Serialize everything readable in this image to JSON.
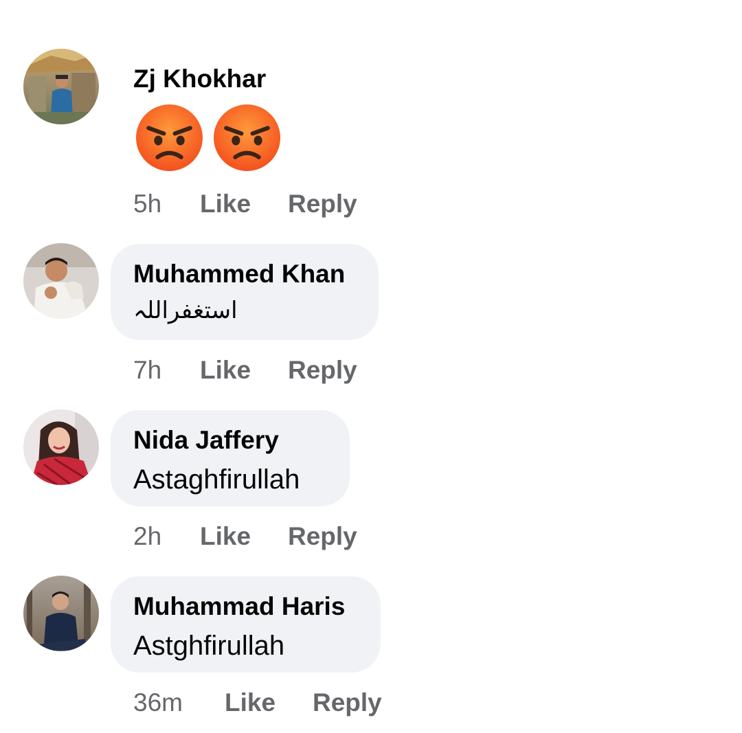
{
  "comments": [
    {
      "author": "Zj Khokhar",
      "reaction_icons": [
        "angry-face-emoji",
        "angry-face-emoji"
      ],
      "time": "5h",
      "like_label": "Like",
      "reply_label": "Reply"
    },
    {
      "author": "Muhammed Khan",
      "text": "استغفراللہ",
      "time": "7h",
      "like_label": "Like",
      "reply_label": "Reply"
    },
    {
      "author": "Nida Jaffery",
      "text": "Astaghfirullah",
      "time": "2h",
      "like_label": "Like",
      "reply_label": "Reply"
    },
    {
      "author": "Muhammad Haris",
      "text": "Astghfirullah",
      "time": "36m",
      "like_label": "Like",
      "reply_label": "Reply"
    }
  ],
  "colors": {
    "bubble_bg": "#f0f2f5",
    "name_text": "#050505",
    "meta_text": "#65676b",
    "emoji_fill": "#f4511e"
  }
}
